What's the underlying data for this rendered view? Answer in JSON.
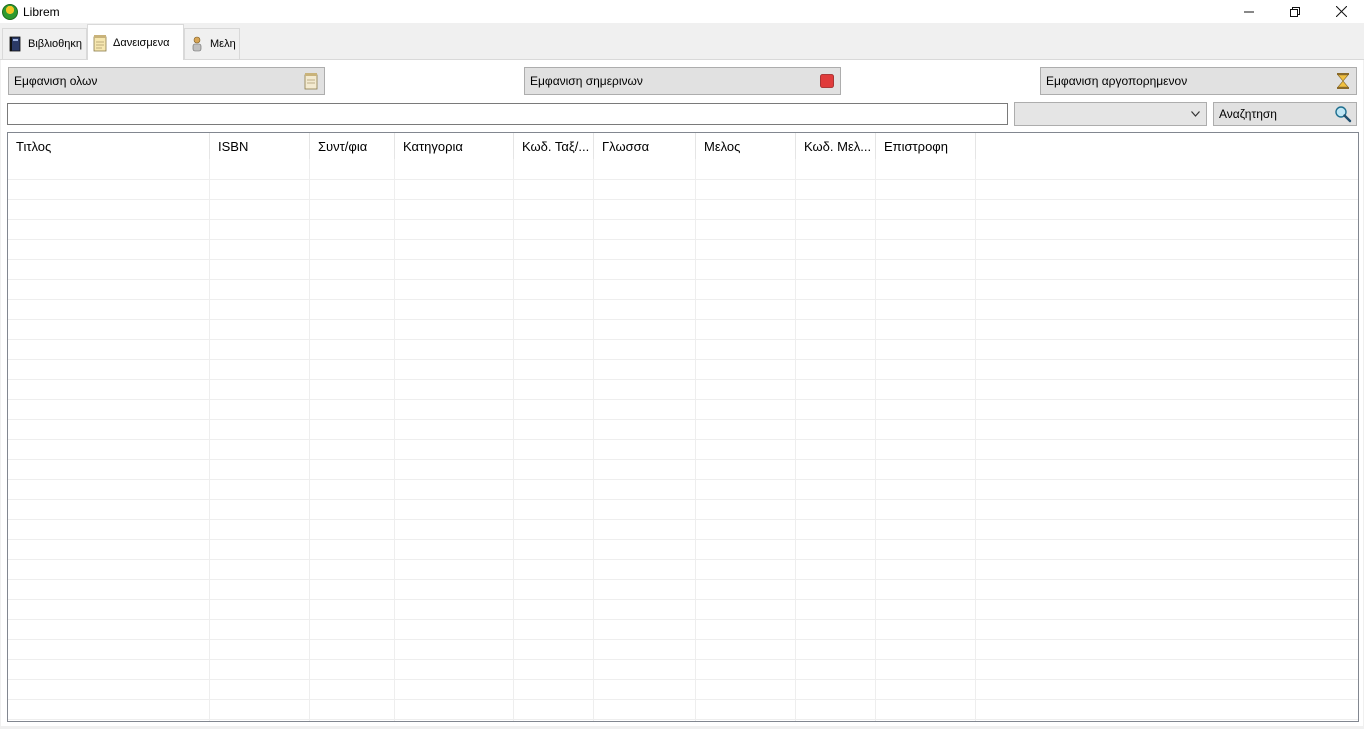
{
  "window": {
    "title": "Librem",
    "controls": [
      "minimize",
      "restore",
      "close"
    ]
  },
  "tabs": [
    {
      "label": "Βιβλιοθηκη",
      "icon": "book-icon",
      "active": false
    },
    {
      "label": "Δανεισμενα",
      "icon": "notepad-icon",
      "active": true
    },
    {
      "label": "Μελη",
      "icon": "person-icon",
      "active": false
    }
  ],
  "filters": {
    "show_all_label": "Εμφανιση ολων",
    "show_today_label": "Εμφανιση σημερινων",
    "show_overdue_label": "Εμφανιση αργοπορημενον"
  },
  "search": {
    "value": "",
    "combo_value": "",
    "button_label": "Αναζητηση"
  },
  "table": {
    "columns": [
      "Τιτλος",
      "ISBN",
      "Συντ/φια",
      "Κατηγορια",
      "Κωδ. Ταξ/...",
      "Γλωσσα",
      "Μελος",
      "Κωδ. Μελ...",
      "Επιστροφη"
    ],
    "rows": []
  },
  "colors": {
    "today_indicator": "#e03c3c",
    "overdue_indicator": "#d9a520"
  }
}
